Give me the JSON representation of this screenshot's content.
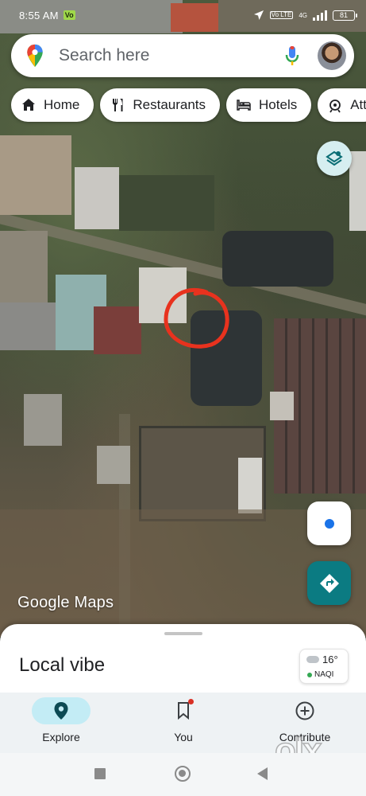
{
  "status_bar": {
    "time": "8:55 AM",
    "badge": "Vo",
    "network_label": "Vo LTE",
    "signal": "4G",
    "battery": "81",
    "icons": [
      "location-arrow-icon",
      "signal-icon",
      "battery-icon"
    ]
  },
  "search": {
    "placeholder": "Search here",
    "icons": [
      "maps-pin-icon",
      "mic-icon",
      "avatar"
    ]
  },
  "chips": [
    {
      "label": "Home",
      "icon": "home-icon"
    },
    {
      "label": "Restaurants",
      "icon": "restaurant-icon"
    },
    {
      "label": "Hotels",
      "icon": "hotel-icon"
    },
    {
      "label": "Att",
      "icon": "attractions-icon"
    }
  ],
  "map": {
    "logo": {
      "brand": "Google",
      "product": "Maps"
    },
    "annotation_color": "#e8321e",
    "accent": "#0b7b82",
    "location_dot": "#1a73e8"
  },
  "sheet": {
    "title": "Local vibe",
    "weather": {
      "temp": "16°",
      "aqi": "NAQI"
    }
  },
  "bottom_nav": [
    {
      "label": "Explore",
      "icon": "explore-pin-icon",
      "active": true
    },
    {
      "label": "You",
      "icon": "bookmark-icon",
      "active": false,
      "badge": true
    },
    {
      "label": "Contribute",
      "icon": "add-circle-icon",
      "active": false
    }
  ],
  "watermark": "olx"
}
